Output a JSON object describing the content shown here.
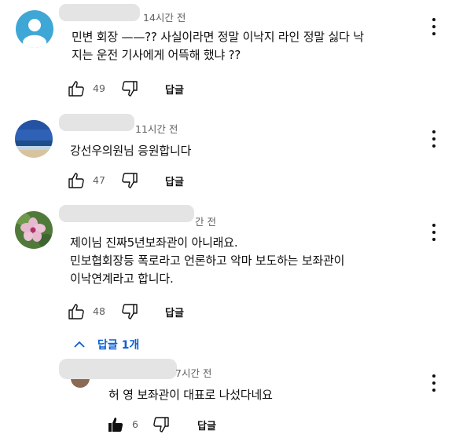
{
  "comments": [
    {
      "time": "14시간 전",
      "lines": [
        "민변 회장 ——?? 사실이라면 정말  이낙지 라인 정말 싫다 낙",
        "지는  운전 기사에게 어뜩해 했냐 ??"
      ],
      "likes": "49",
      "reply_label": "답글"
    },
    {
      "time": "11시간 전",
      "lines": [
        "강선우의원님 응원합니다"
      ],
      "likes": "47",
      "reply_label": "답글"
    },
    {
      "time": "간 전",
      "lines": [
        "제이님  진짜5년보좌관이  아니래요.",
        "민보협회장등  폭로라고  언론하고  악마 보도하는  보좌관이",
        "이낙연계라고 합니다."
      ],
      "likes": "48",
      "reply_label": "답글"
    }
  ],
  "replies_toggle": "답글 1개",
  "reply": {
    "time": "7시간 전",
    "text": "허 영 보좌관이 대표로 나섰다네요",
    "likes": "6",
    "reply_label": "답글"
  },
  "colors": {
    "accent": "#065fd4",
    "text": "#0f0f0f",
    "meta": "#606060"
  },
  "icons": [
    "default-avatar-icon",
    "thumbs-up-icon",
    "thumbs-down-icon",
    "more-vert-icon",
    "chevron-up-icon",
    "thumbs-up-filled-icon"
  ]
}
